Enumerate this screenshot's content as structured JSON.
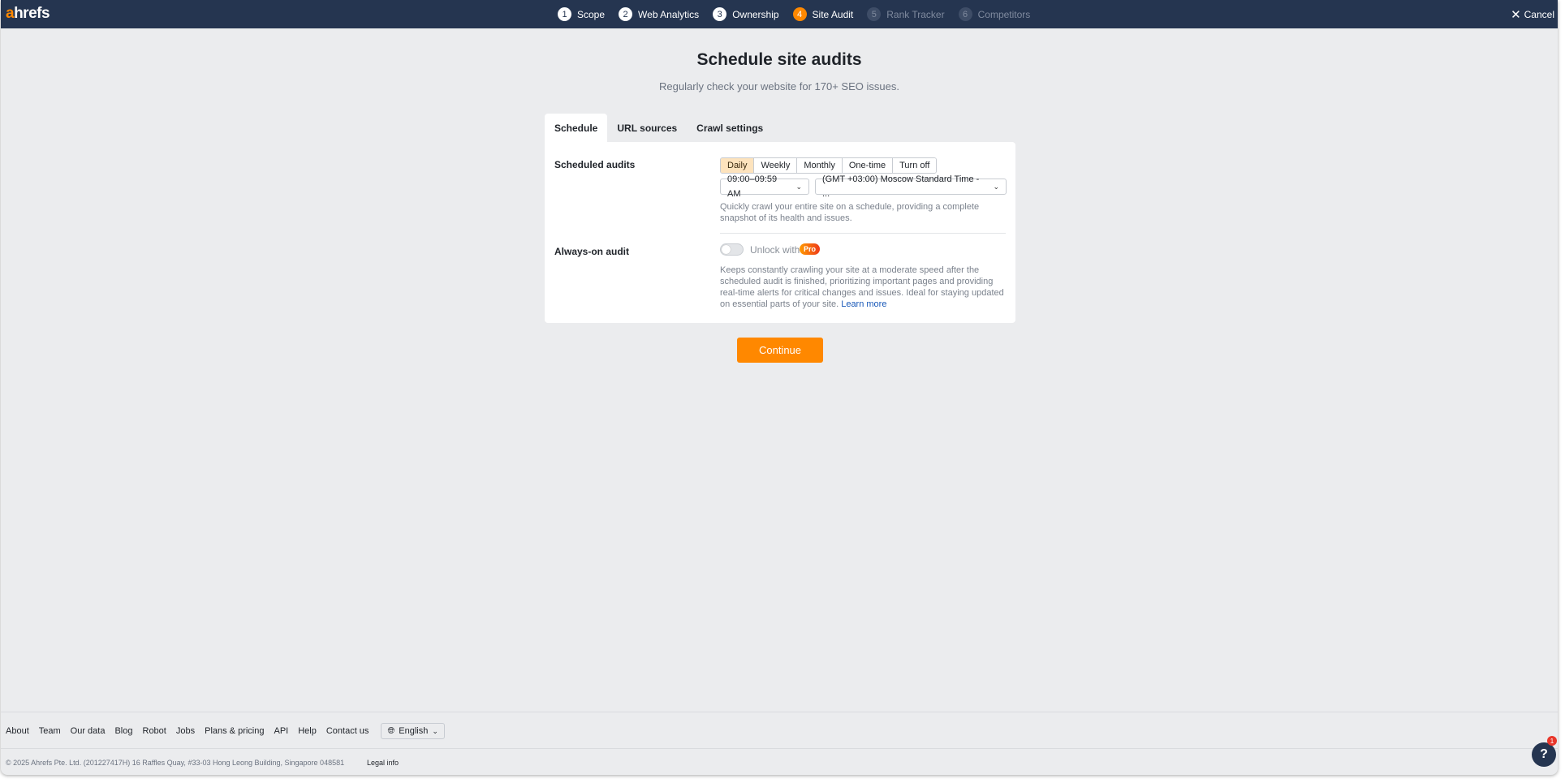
{
  "header": {
    "logo": {
      "accent": "a",
      "rest": "hrefs"
    },
    "steps": [
      {
        "num": "1",
        "label": "Scope",
        "state": "done"
      },
      {
        "num": "2",
        "label": "Web Analytics",
        "state": "done"
      },
      {
        "num": "3",
        "label": "Ownership",
        "state": "done"
      },
      {
        "num": "4",
        "label": "Site Audit",
        "state": "active"
      },
      {
        "num": "5",
        "label": "Rank Tracker",
        "state": "todo"
      },
      {
        "num": "6",
        "label": "Competitors",
        "state": "todo"
      }
    ],
    "cancel_label": "Cancel"
  },
  "main": {
    "title": "Schedule site audits",
    "subtitle": "Regularly check your website for 170+ SEO issues.",
    "tabs": [
      {
        "label": "Schedule",
        "active": true
      },
      {
        "label": "URL sources",
        "active": false
      },
      {
        "label": "Crawl settings",
        "active": false
      }
    ]
  },
  "schedule": {
    "scheduled_label": "Scheduled audits",
    "frequency_options": [
      "Daily",
      "Weekly",
      "Monthly",
      "One-time",
      "Turn off"
    ],
    "frequency_selected": "Daily",
    "time_value": "09:00–09:59 AM",
    "timezone_value": "(GMT +03:00) Moscow Standard Time - ...",
    "scheduled_description": "Quickly crawl your entire site on a schedule, providing a complete snapshot of its health and issues.",
    "always_on_label": "Always-on audit",
    "always_on_enabled": false,
    "unlock_text": "Unlock with",
    "pro_badge": "Pro",
    "always_on_description": "Keeps constantly crawling your site at a moderate speed after the scheduled audit is finished, prioritizing important pages and providing real-time alerts for critical changes and issues. Ideal for staying updated on essential parts of your site.",
    "learn_more": "Learn more",
    "continue_label": "Continue"
  },
  "footer": {
    "links": [
      "About",
      "Team",
      "Our data",
      "Blog",
      "Robot",
      "Jobs",
      "Plans & pricing",
      "API",
      "Help",
      "Contact us"
    ],
    "language": "English",
    "copyright": "© 2025 Ahrefs Pte. Ltd. (201227417H) 16 Raffles Quay, #33-03 Hong Leong Building, Singapore 048581",
    "legal": "Legal info"
  },
  "help": {
    "label": "?",
    "badge_count": "1"
  },
  "colors": {
    "topbar": "#253550",
    "accent": "#ff8800",
    "background": "#ebecee",
    "selected_segment": "#fde3bd",
    "link": "#1858b8"
  }
}
